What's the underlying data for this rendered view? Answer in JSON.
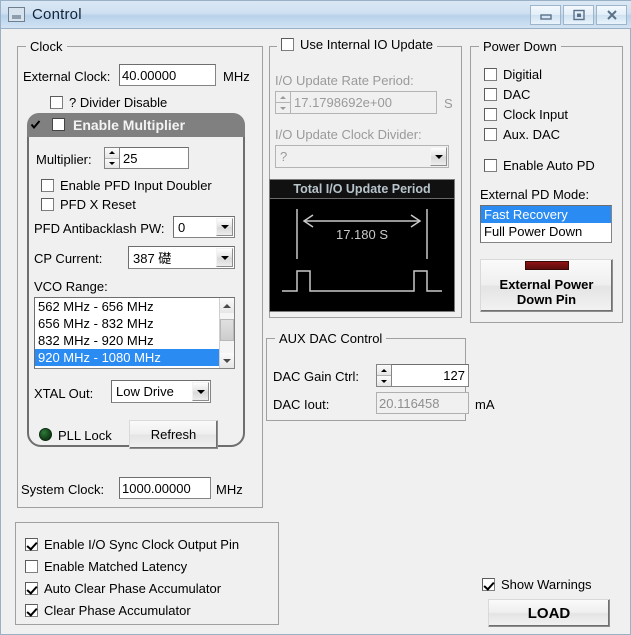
{
  "window": {
    "title": "Control",
    "icon": "window-restore-icon",
    "buttons": [
      {
        "name": "minimize-button",
        "glyph": "minimize-icon"
      },
      {
        "name": "maximize-button",
        "glyph": "maximize-icon"
      },
      {
        "name": "close-button",
        "glyph": "close-icon"
      }
    ]
  },
  "clock": {
    "legend": "Clock",
    "external_clock_label": "External Clock:",
    "external_clock_value": "40.00000",
    "external_clock_unit": "MHz",
    "divider_disable_label": "? Divider Disable",
    "divider_disable_checked": false,
    "multiplier_group": {
      "header_label": "Enable Multiplier",
      "header_checked": true,
      "multiplier_label": "Multiplier:",
      "multiplier_value": "25",
      "pfd_input_doubler_label": "Enable PFD Input Doubler",
      "pfd_input_doubler_checked": false,
      "pfd_x_reset_label": "PFD X Reset",
      "pfd_x_reset_checked": false,
      "pfd_antibacklash_label": "PFD Antibacklash PW:",
      "pfd_antibacklash_value": "0",
      "cp_current_label": "CP Current:",
      "cp_current_value": "387 礎",
      "vco_range_label": "VCO Range:",
      "vco_range_items": [
        "562 MHz - 656 MHz",
        "656 MHz - 832 MHz",
        "832 MHz - 920 MHz",
        "920 MHz - 1080 MHz"
      ],
      "vco_range_selected_index": 3,
      "xtal_out_label": "XTAL Out:",
      "xtal_out_value": "Low Drive",
      "pll_lock_label": "PLL Lock",
      "pll_lock_led_color": "#1c5c27",
      "refresh_label": "Refresh"
    },
    "system_clock_label": "System Clock:",
    "system_clock_value": "1000.00000",
    "system_clock_unit": "MHz"
  },
  "io_update": {
    "use_internal_label": "Use Internal IO Update",
    "use_internal_checked": false,
    "rate_period_label": "I/O Update Rate Period:",
    "rate_period_value": "17.1798692e+00",
    "rate_period_unit": "S",
    "clock_divider_label": "I/O Update Clock Divider:",
    "clock_divider_value": "?",
    "total_period": {
      "title": "Total I/O Update Period",
      "value": "17.180 S",
      "background": "#000000",
      "foreground": "#c9c9c9"
    }
  },
  "aux_dac": {
    "legend": "AUX DAC Control",
    "gain_label": "DAC Gain Ctrl:",
    "gain_value": "127",
    "iout_label": "DAC Iout:",
    "iout_value": "20.116458",
    "iout_unit": "mA"
  },
  "power_down": {
    "legend": "Power Down",
    "checkboxes": [
      {
        "label": "Digitial",
        "checked": false
      },
      {
        "label": "DAC",
        "checked": false
      },
      {
        "label": "Clock Input",
        "checked": false
      },
      {
        "label": "Aux. DAC",
        "checked": false
      },
      {
        "label": "Enable Auto PD",
        "checked": false
      }
    ],
    "external_pd_mode_label": "External PD Mode:",
    "external_pd_mode_items": [
      "Fast Recovery",
      "Full Power Down"
    ],
    "external_pd_mode_selected_index": 0,
    "external_pd_pin_line1": "External Power",
    "external_pd_pin_line2": "Down Pin",
    "external_pd_pin_led_color": "#7a1111"
  },
  "bottom_options": {
    "checkboxes": [
      {
        "label": "Enable I/O Sync Clock Output Pin",
        "checked": true
      },
      {
        "label": "Enable Matched Latency",
        "checked": false
      },
      {
        "label": "Auto Clear Phase Accumulator",
        "checked": true
      },
      {
        "label": "Clear Phase Accumulator",
        "checked": true
      }
    ]
  },
  "actions": {
    "show_warnings_label": "Show Warnings",
    "show_warnings_checked": true,
    "load_label": "LOAD"
  }
}
